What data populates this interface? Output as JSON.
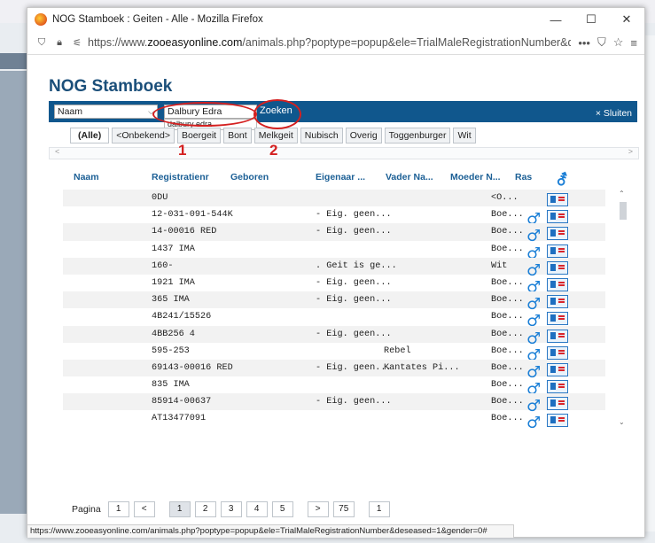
{
  "window": {
    "title": "NOG Stamboek : Geiten - Alle - Mozilla Firefox",
    "url_prefix": "https://www.",
    "url_domain": "zooeasyonline.com",
    "url_rest": "/animals.php?poptype=popup&ele=TrialMaleRegistrationNumber&desea",
    "more_label": "•••"
  },
  "page": {
    "title": "NOG Stamboek"
  },
  "search": {
    "field": "Naam",
    "value": "Dalbury Edra",
    "suggestion": "dalbury edra",
    "button": "Zoeken",
    "close": "× Sluiten"
  },
  "filters": [
    "(Alle)",
    "<Onbekend>",
    "Boergeit",
    "Bont",
    "Melkgeit",
    "Nubisch",
    "Overig",
    "Toggenburger",
    "Wit"
  ],
  "columns": {
    "naam": "Naam",
    "reg": "Registratienr",
    "geboren": "Geboren",
    "eigenaar": "Eigenaar ...",
    "vader": "Vader Na...",
    "moeder": "Moeder N...",
    "ras": "Ras"
  },
  "rows": [
    {
      "reg": "0DU",
      "eig": "",
      "vader": "",
      "ras": "<O...",
      "male": false
    },
    {
      "reg": "12-031-091-544K",
      "eig": "- Eig. geen...",
      "vader": "",
      "ras": "Boe...",
      "male": true
    },
    {
      "reg": "14-00016 RED",
      "eig": "- Eig. geen...",
      "vader": "",
      "ras": "Boe...",
      "male": true
    },
    {
      "reg": "1437 IMA",
      "eig": "",
      "vader": "",
      "ras": "Boe...",
      "male": true
    },
    {
      "reg": "160-",
      "eig": ". Geit is ge...",
      "vader": "",
      "ras": "Wit",
      "male": true
    },
    {
      "reg": "1921 IMA",
      "eig": "- Eig. geen...",
      "vader": "",
      "ras": "Boe...",
      "male": true
    },
    {
      "reg": "365 IMA",
      "eig": "- Eig. geen...",
      "vader": "",
      "ras": "Boe...",
      "male": true
    },
    {
      "reg": "4B241/15526",
      "eig": "",
      "vader": "",
      "ras": "Boe...",
      "male": true
    },
    {
      "reg": "4BB256 4",
      "eig": "- Eig. geen...",
      "vader": "",
      "ras": "Boe...",
      "male": true
    },
    {
      "reg": "595-253",
      "eig": "",
      "vader": "Rebel",
      "ras": "Boe...",
      "male": true
    },
    {
      "reg": "69143-00016 RED",
      "eig": "- Eig. geen...",
      "vader": "Kantates Pi...",
      "ras": "Boe...",
      "male": true
    },
    {
      "reg": "835 IMA",
      "eig": "",
      "vader": "",
      "ras": "Boe...",
      "male": true
    },
    {
      "reg": "85914-00637",
      "eig": "- Eig. geen...",
      "vader": "",
      "ras": "Boe...",
      "male": true
    },
    {
      "reg": "AT13477091",
      "eig": "",
      "vader": "",
      "ras": "Boe...",
      "male": true
    }
  ],
  "pager": {
    "label": "Pagina",
    "first": "1",
    "prev": "<",
    "pages": [
      "1",
      "2",
      "3",
      "4",
      "5"
    ],
    "next": ">",
    "last": "75",
    "goto": "1"
  },
  "status_url": "https://www.zooeasyonline.com/animals.php?poptype=popup&ele=TrialMaleRegistrationNumber&deseased=1&gender=0#",
  "annotations": {
    "n1": "1",
    "n2": "2",
    "color": "#d42020"
  },
  "colors": {
    "header_blue": "#10578d",
    "title_blue": "#1b4f7a",
    "icon_blue": "#1b7fd6"
  }
}
